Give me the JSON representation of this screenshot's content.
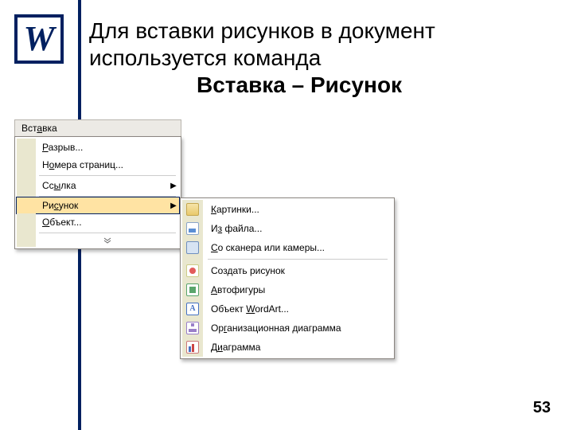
{
  "logo_letter": "W",
  "heading": {
    "line1": "Для вставки рисунков в документ используется команда",
    "line2": "Вставка – Рисунок"
  },
  "page_number": "53",
  "menu": {
    "title_html": "Вст<u>а</u>вка",
    "items": [
      {
        "html": "<u>Р</u>азрыв...",
        "arrow": false
      },
      {
        "html": "Н<u>о</u>мера страниц...",
        "arrow": false
      },
      {
        "html": "Сс<u>ы</u>лка",
        "arrow": true
      },
      {
        "html": "Ри<u>с</u>унок",
        "arrow": true,
        "highlight": true
      },
      {
        "html": "<u>О</u>бъект...",
        "arrow": false
      }
    ]
  },
  "submenu": {
    "items": [
      {
        "icon": "pic",
        "html": "<u>К</u>артинки..."
      },
      {
        "icon": "file",
        "html": "И<u>з</u> файла..."
      },
      {
        "icon": "cam",
        "html": "<u>С</u>о сканера или камеры..."
      },
      {
        "icon": "draw",
        "html": "Соз<u>д</u>ать рисунок",
        "sep_before": true
      },
      {
        "icon": "shape",
        "html": "<u>А</u>втофигуры"
      },
      {
        "icon": "wart",
        "html": "Объект <u>W</u>ordArt..."
      },
      {
        "icon": "org",
        "html": "Ор<u>г</u>анизационная диаграмма"
      },
      {
        "icon": "chart",
        "html": "Д<u>и</u>аграмма"
      }
    ]
  }
}
